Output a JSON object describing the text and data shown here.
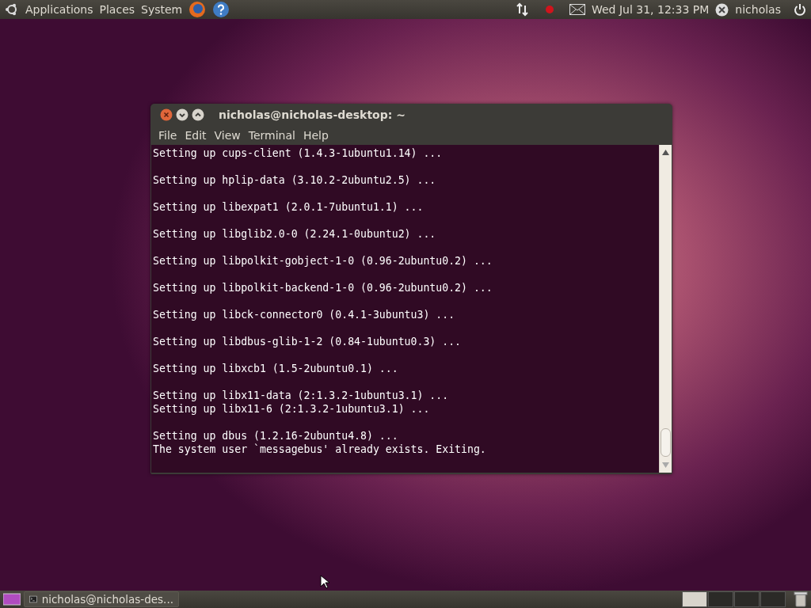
{
  "top_panel": {
    "menus": [
      {
        "label": "Applications"
      },
      {
        "label": "Places"
      },
      {
        "label": "System"
      }
    ],
    "clock": "Wed Jul 31, 12:33 PM",
    "user": "nicholas"
  },
  "window": {
    "title": "nicholas@nicholas-desktop: ~",
    "menu": [
      "File",
      "Edit",
      "View",
      "Terminal",
      "Help"
    ],
    "output": [
      [
        "Setting up cups-client (1.4.3-1ubuntu1.14) ..."
      ],
      [
        "Setting up hplip-data (3.10.2-2ubuntu2.5) ..."
      ],
      [
        "Setting up libexpat1 (2.0.1-7ubuntu1.1) ..."
      ],
      [
        "Setting up libglib2.0-0 (2.24.1-0ubuntu2) ..."
      ],
      [
        "Setting up libpolkit-gobject-1-0 (0.96-2ubuntu0.2) ..."
      ],
      [
        "Setting up libpolkit-backend-1-0 (0.96-2ubuntu0.2) ..."
      ],
      [
        "Setting up libck-connector0 (0.4.1-3ubuntu3) ..."
      ],
      [
        "Setting up libdbus-glib-1-2 (0.84-1ubuntu0.3) ..."
      ],
      [
        "Setting up libxcb1 (1.5-2ubuntu0.1) ..."
      ],
      [
        "Setting up libx11-data (2:1.3.2-1ubuntu3.1) ...",
        "Setting up libx11-6 (2:1.3.2-1ubuntu3.1) ..."
      ],
      [
        "Setting up dbus (1.2.16-2ubuntu4.8) ...",
        "The system user `messagebus' already exists. Exiting."
      ]
    ]
  },
  "bottom_panel": {
    "tasks": [
      {
        "label": "nicholas@nicholas-des...",
        "selected": false
      }
    ],
    "workspaces": [
      {
        "selected": true
      },
      {
        "selected": false
      },
      {
        "selected": false
      },
      {
        "selected": false
      }
    ]
  }
}
